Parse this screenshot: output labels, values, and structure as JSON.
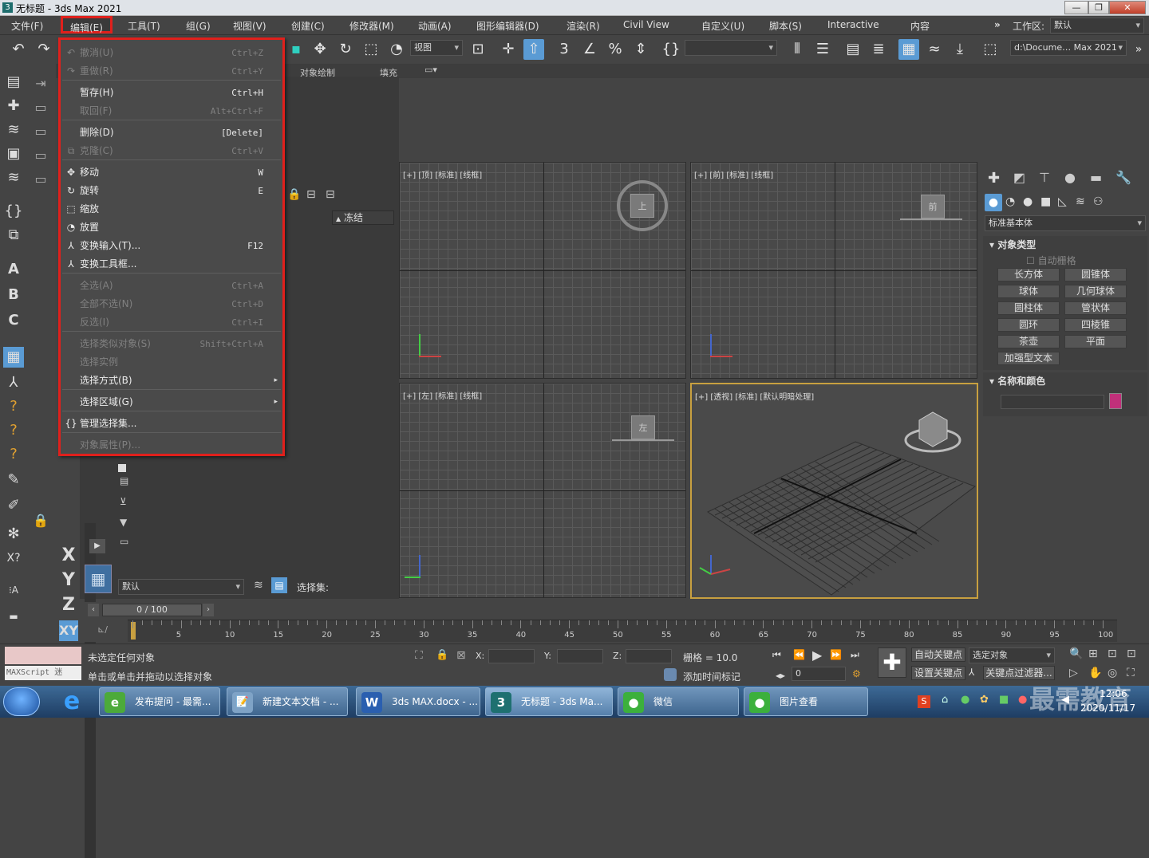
{
  "window": {
    "title": "无标题 - 3ds Max 2021",
    "app_icon": "3",
    "min": "—",
    "restore": "❐",
    "close": "✕"
  },
  "menubar": {
    "items": [
      "文件(F)",
      "编辑(E)",
      "工具(T)",
      "组(G)",
      "视图(V)",
      "创建(C)",
      "修改器(M)",
      "动画(A)",
      "图形编辑器(D)",
      "渲染(R)",
      "Civil View",
      "自定义(U)",
      "脚本(S)",
      "Interactive",
      "内容"
    ],
    "overflow": "»",
    "workspace_label": "工作区:",
    "workspace_value": "默认"
  },
  "toolbar": {
    "view_dropdown": "视图",
    "path_dropdown": "d:\\Docume… Max 2021"
  },
  "ribbon": {
    "tabs": [
      "对象绘制",
      "填充"
    ]
  },
  "edit_menu": {
    "items": [
      {
        "label": "撤消(U)",
        "shortcut": "Ctrl+Z",
        "enabled": false,
        "icon": "↶"
      },
      {
        "label": "重做(R)",
        "shortcut": "Ctrl+Y",
        "enabled": false,
        "icon": "↷"
      },
      {
        "label": "暂存(H)",
        "shortcut": "Ctrl+H",
        "enabled": true,
        "icon": ""
      },
      {
        "label": "取回(F)",
        "shortcut": "Alt+Ctrl+F",
        "enabled": false,
        "icon": ""
      },
      {
        "label": "删除(D)",
        "shortcut": "[Delete]",
        "enabled": true,
        "icon": ""
      },
      {
        "label": "克隆(C)",
        "shortcut": "Ctrl+V",
        "enabled": false,
        "icon": "⧉"
      },
      {
        "label": "移动",
        "shortcut": "W",
        "enabled": true,
        "icon": "✥"
      },
      {
        "label": "旋转",
        "shortcut": "E",
        "enabled": true,
        "icon": "↻"
      },
      {
        "label": "缩放",
        "shortcut": "",
        "enabled": true,
        "icon": "⬚"
      },
      {
        "label": "放置",
        "shortcut": "",
        "enabled": true,
        "icon": "◔"
      },
      {
        "label": "变换输入(T)...",
        "shortcut": "F12",
        "enabled": true,
        "icon": "⅄"
      },
      {
        "label": "变换工具框...",
        "shortcut": "",
        "enabled": true,
        "icon": "⅄"
      },
      {
        "label": "全选(A)",
        "shortcut": "Ctrl+A",
        "enabled": false,
        "icon": ""
      },
      {
        "label": "全部不选(N)",
        "shortcut": "Ctrl+D",
        "enabled": false,
        "icon": ""
      },
      {
        "label": "反选(I)",
        "shortcut": "Ctrl+I",
        "enabled": false,
        "icon": ""
      },
      {
        "label": "选择类似对象(S)",
        "shortcut": "Shift+Ctrl+A",
        "enabled": false,
        "icon": ""
      },
      {
        "label": "选择实例",
        "shortcut": "",
        "enabled": false,
        "icon": ""
      },
      {
        "label": "选择方式(B)",
        "shortcut": "",
        "enabled": true,
        "icon": "",
        "submenu": "▸"
      },
      {
        "label": "选择区域(G)",
        "shortcut": "",
        "enabled": true,
        "icon": "",
        "submenu": "▸"
      },
      {
        "label": "管理选择集...",
        "shortcut": "",
        "enabled": true,
        "icon": "{}"
      },
      {
        "label": "对象属性(P)...",
        "shortcut": "",
        "enabled": false,
        "icon": ""
      }
    ]
  },
  "explorer": {
    "column_freeze": "冻结",
    "layer_dropdown": "默认",
    "selection_set_label": "选择集:"
  },
  "viewports": {
    "top": "[+] [顶] [标准] [线框]",
    "front": "[+] [前] [标准] [线框]",
    "left": "[+] [左] [标准] [线框]",
    "persp": "[+] [透视] [标准] [默认明暗处理]",
    "cube_top": "上",
    "cube_front": "前",
    "cube_left": "左"
  },
  "command_panel": {
    "category_dropdown": "标准基本体",
    "rollout_object_type": "对象类型",
    "autogrid": "自动栅格",
    "buttons": [
      "长方体",
      "圆锥体",
      "球体",
      "几何球体",
      "圆柱体",
      "管状体",
      "圆环",
      "四棱锥",
      "茶壶",
      "平面",
      "加强型文本"
    ],
    "rollout_name_color": "名称和颜色",
    "object_color": "#c0307a"
  },
  "timeline": {
    "slider": "0 / 100",
    "ticks": [
      "5",
      "10",
      "15",
      "20",
      "25",
      "30",
      "35",
      "40",
      "45",
      "50",
      "55",
      "60",
      "65",
      "70",
      "75",
      "80",
      "85",
      "90",
      "95",
      "100"
    ]
  },
  "status": {
    "maxscript": "MAXScript 迷",
    "line1": "未选定任何对象",
    "line2": "单击或单击并拖动以选择对象",
    "x_label": "X:",
    "y_label": "Y:",
    "z_label": "Z:",
    "grid": "栅格 = 10.0",
    "add_time_tag": "添加时间标记",
    "auto_key": "自动关键点",
    "set_key": "设置关键点",
    "selected_object": "选定对象",
    "key_filters": "关键点过滤器...",
    "frame": "0"
  },
  "xyz": [
    "X",
    "Y",
    "Z",
    "XY"
  ],
  "taskbar": {
    "tasks": [
      {
        "label": "发布提问 - 最需...",
        "icon": "e",
        "color": "#4caa3a"
      },
      {
        "label": "新建文本文档 - ...",
        "icon": "📝",
        "color": "#7fa3c6"
      },
      {
        "label": "3ds MAX.docx - ...",
        "icon": "W",
        "color": "#2a5fb0"
      },
      {
        "label": "无标题 - 3ds Ma...",
        "icon": "3",
        "color": "#1e7070"
      },
      {
        "label": "微信",
        "icon": "●",
        "color": "#3cb03c"
      },
      {
        "label": "图片查看",
        "icon": "●",
        "color": "#3cb03c"
      }
    ],
    "clock_time": "12:06",
    "clock_date": "2020/11/17",
    "watermark": "最需教育"
  }
}
